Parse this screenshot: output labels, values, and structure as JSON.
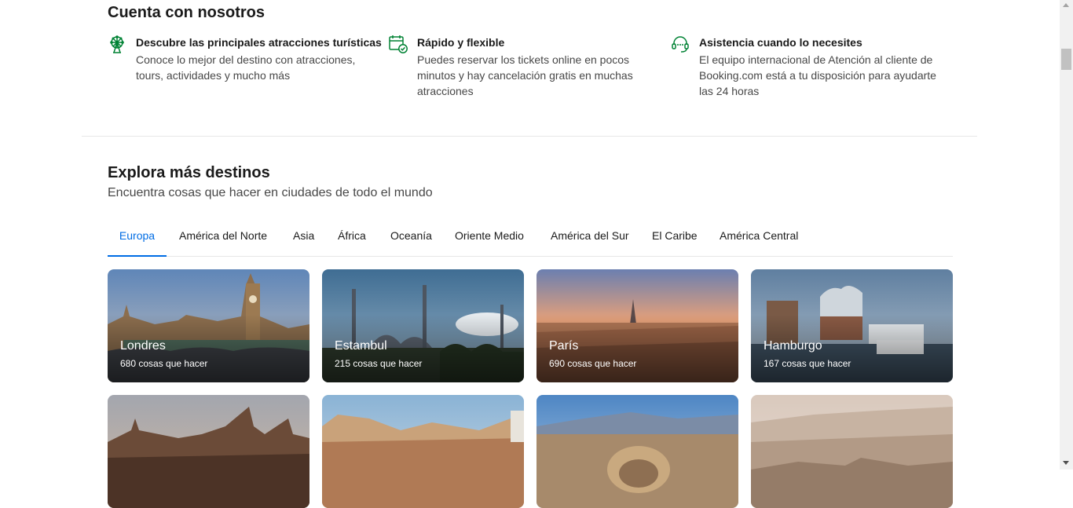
{
  "colors": {
    "brand_green": "#008234",
    "accent_blue": "#006ce4"
  },
  "about": {
    "title": "Cuenta con nosotros",
    "features": [
      {
        "icon": "ferris-wheel-icon",
        "title": "Descubre las principales atracciones turísticas",
        "lines": [
          "Conoce lo mejor del destino con atracciones,",
          "tours, actividades y mucho más"
        ]
      },
      {
        "icon": "calendar-check-icon",
        "title": "Rápido y flexible",
        "lines": [
          "Puedes reservar los tickets online en pocos",
          "minutos y hay cancelación gratis en muchas",
          "atracciones"
        ]
      },
      {
        "icon": "headset-icon",
        "title": "Asistencia cuando lo necesites",
        "lines": [
          "El equipo internacional de Atención al cliente de",
          "Booking.com está a tu disposición para ayudarte",
          "las 24 horas"
        ]
      }
    ]
  },
  "explore": {
    "title": "Explora más destinos",
    "subtitle": "Encuentra cosas que hacer en ciudades de todo el mundo",
    "tabs": [
      "Europa",
      "América del Norte",
      "Asia",
      "África",
      "Oceanía",
      "Oriente Medio",
      "América del Sur",
      "El Caribe",
      "América Central"
    ],
    "active_tab": "Europa",
    "cards": [
      {
        "city": "Londres",
        "count": "680 cosas que hacer"
      },
      {
        "city": "Estambul",
        "count": "215 cosas que hacer"
      },
      {
        "city": "París",
        "count": "690 cosas que hacer"
      },
      {
        "city": "Hamburgo",
        "count": "167 cosas que hacer"
      }
    ]
  }
}
